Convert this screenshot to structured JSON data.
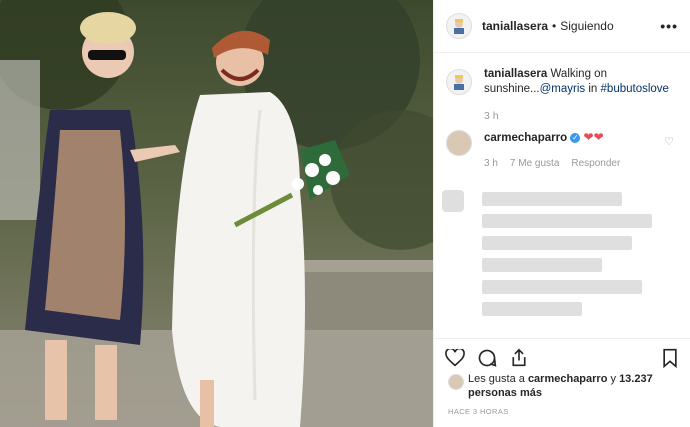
{
  "post": {
    "author": "taniallasera",
    "separator": "•",
    "follow_status": "Siguiendo",
    "more_label": "•••",
    "caption_author": "taniallasera",
    "caption_text": "Walking on sunshine...",
    "caption_mention": "@mayris",
    "caption_in": "in",
    "caption_hashtag": "#bubutoslove",
    "caption_time": "3 h"
  },
  "comment": {
    "author": "carmechaparro",
    "verified_mark": "✓",
    "text": "❤❤",
    "time": "3 h",
    "likes": "7 Me gusta",
    "reply": "Responder",
    "like_icon": "♡"
  },
  "footer": {
    "likes_prefix": "Les gusta a",
    "likes_user": "carmechaparro",
    "likes_middle": "y",
    "likes_count": "13.237 personas más",
    "posted": "HACE 3 HORAS"
  },
  "icons": [
    "heart-icon",
    "comment-icon",
    "share-icon",
    "bookmark-icon"
  ]
}
